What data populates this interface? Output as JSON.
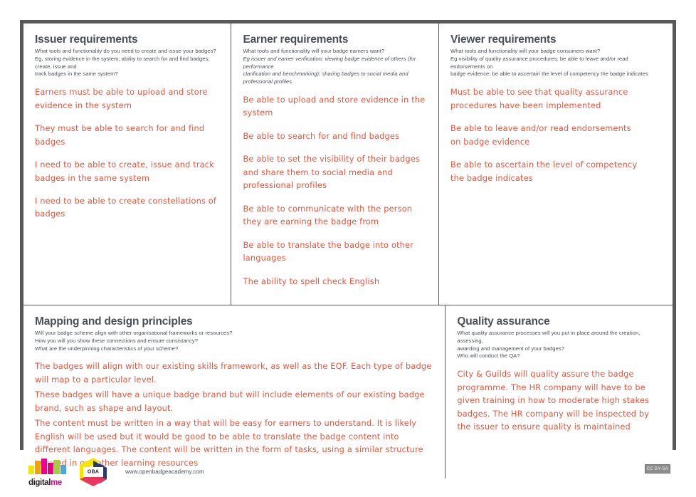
{
  "canvas": {
    "border_color": "#58585b",
    "note_color": "#e8553c",
    "heading_color": "#4a4f58"
  },
  "sections": {
    "issuer": {
      "title": "Issuer requirements",
      "prompt_line1": "What tools and functionality do you need to create and issue your badges?",
      "prompt_line2": "Eg, storing evidence in the system; ability to search for and find badges; create, issue and",
      "prompt_line3": "track badges in the same system?",
      "notes": [
        "Earners must be able to upload and store evidence in the system",
        "They must be able to search for and find badges",
        "I need to be able to create, issue and track badges in the same system",
        "I need to be able to create constellations of badges"
      ]
    },
    "earner": {
      "title": "Earner requirements",
      "prompt_line1": "What tools and functionality will your badge earners want?",
      "prompt_line2": "Eg issuer and earner verification; viewing badge evidence of others (for performance",
      "prompt_line3": "clarification and benchmarking); sharing badges to social media and professional profiles.",
      "notes": [
        "Be able to upload and store evidence in the system",
        "Be able to search for and find badges",
        "Be able to set the visibility of their badges and share them to social media and professional profiles",
        "Be able to communicate with the person they are earning the badge from",
        "Be able to translate the badge into other languages",
        "The ability to spell check English"
      ]
    },
    "viewer": {
      "title": "Viewer requirements",
      "prompt_line1": "What tools and functionality will your badge consumers want?",
      "prompt_line2": "Eg  visibility of quality assurance procedures; be able to leave and/or read endorsements on",
      "prompt_line3": "badge evidence; be able to ascertain the level of competency the badge indicates",
      "notes": [
        "Must be able to see that quality assurance procedures have been implemented",
        "Be able to leave and/or read endorsements on badge evidence",
        "Be able to ascertain the level of competency the badge indicates"
      ]
    },
    "mapping": {
      "title": "Mapping and design principles",
      "prompt_line1": "Will your badge scheme align with other organisational frameworks or resources?",
      "prompt_line2": "How you will you show these connections and ensure consistancy?",
      "prompt_line3": "What are the underpinning characteristics of your scheme?",
      "notes": [
        "The badges will align with our existing skills framework, as well as the EQF. Each type of badge will map to a particular level.",
        "These badges will have a unique badge brand but will include elements of our existing badge brand, such as shape and layout.",
        "The content must be written in a way that will be easy for earners to understand. It is likely English will be used but it would be good to be able to translate the badge content into different languages. The content will be written in the form of tasks, using a similar structure as used in our other learning resources"
      ]
    },
    "quality_assurance": {
      "title": "Quality assurance",
      "prompt_line1": "What quality assurance processes will you put in place around the creation, assessing,",
      "prompt_line2": "awarding and management of your badges?",
      "prompt_line3": "Who will conduct the QA?",
      "notes": [
        "City & Guilds will quality assure the badge programme. The HR company will have to be given training in how to moderate high stakes badges. The HR company will be inspected by the issuer to ensure quality is maintained"
      ]
    }
  },
  "footer": {
    "digitalme": {
      "word_black": "digital",
      "word_pink": "me",
      "bar_colors": [
        "#f6e400",
        "#f0a400",
        "#ec008c",
        "#e6007e",
        "#a3cf3d",
        "#4aa8df",
        "#2e6db4"
      ]
    },
    "oba": {
      "label": "OBA"
    },
    "site_url": "www.openbadgeacademy.com",
    "license_badge": "CC BY-SA"
  }
}
